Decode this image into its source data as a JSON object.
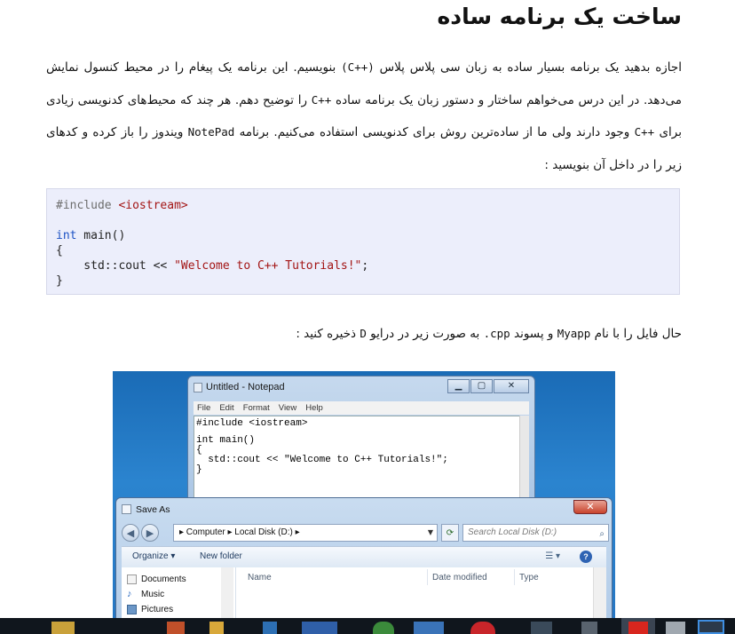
{
  "article": {
    "title": "ساخت یک برنامه ساده",
    "para1": {
      "t1": "اجازه بدهید یک برنامه بسیار ساده به زبان سی پلاس پلاس ",
      "c1": "(C++)",
      "t2": " بنویسیم. این برنامه یک پیغام را در محیط کنسول نمایش می‌دهد. در این درس می‌خواهم ساختار و دستور زبان یک برنامه ساده ",
      "c2": "C++",
      "t3": " را توضیح دهم. هر چند که محیط‌های کدنویسی زیادی برای ",
      "c3": "C++",
      "t4": " وجود دارند ولی ما از ساده‌ترین روش برای کدنویسی استفاده می‌کنیم. برنامه ",
      "c4": "NotePad",
      "t5": " ویندوز را باز کرده و کدهای زیر را در داخل آن بنویسید :"
    },
    "code": {
      "l1_pre": "#include ",
      "l1_inc": "<iostream>",
      "l2_type": "int",
      "l2_rest": " main()",
      "l3": "{",
      "l4_a": "    std::cout << ",
      "l4_str": "\"Welcome to C++ Tutorials!\"",
      "l4_b": ";",
      "l5": "}"
    },
    "para2": {
      "t1": "حال فایل را با نام ",
      "c1": "Myapp",
      "t2": " و پسوند ",
      "c2": ".cpp",
      "t3": " به صورت زیر در درایو ",
      "c3": "D",
      "t4": " ذخیره کنید :"
    }
  },
  "screenshot": {
    "notepad": {
      "title": "Untitled - Notepad",
      "menu": [
        "File",
        "Edit",
        "Format",
        "View",
        "Help"
      ],
      "lines": [
        "#include <iostream>",
        "int main()",
        "{",
        "  std::cout << \"Welcome to C++ Tutorials!\";",
        "}"
      ],
      "buttons": {
        "min": "▁",
        "max": "▢",
        "close": "✕"
      }
    },
    "saveas": {
      "title": "Save As",
      "close": "✕",
      "address": "▸ Computer ▸ Local Disk (D:) ▸",
      "search_placeholder": "Search Local Disk (D:)",
      "toolbar": {
        "organize": "Organize ▾",
        "new_folder": "New folder"
      },
      "sidebar": [
        "Documents",
        "Music",
        "Pictures"
      ],
      "columns": [
        "Name",
        "Date modified",
        "Type"
      ]
    }
  }
}
